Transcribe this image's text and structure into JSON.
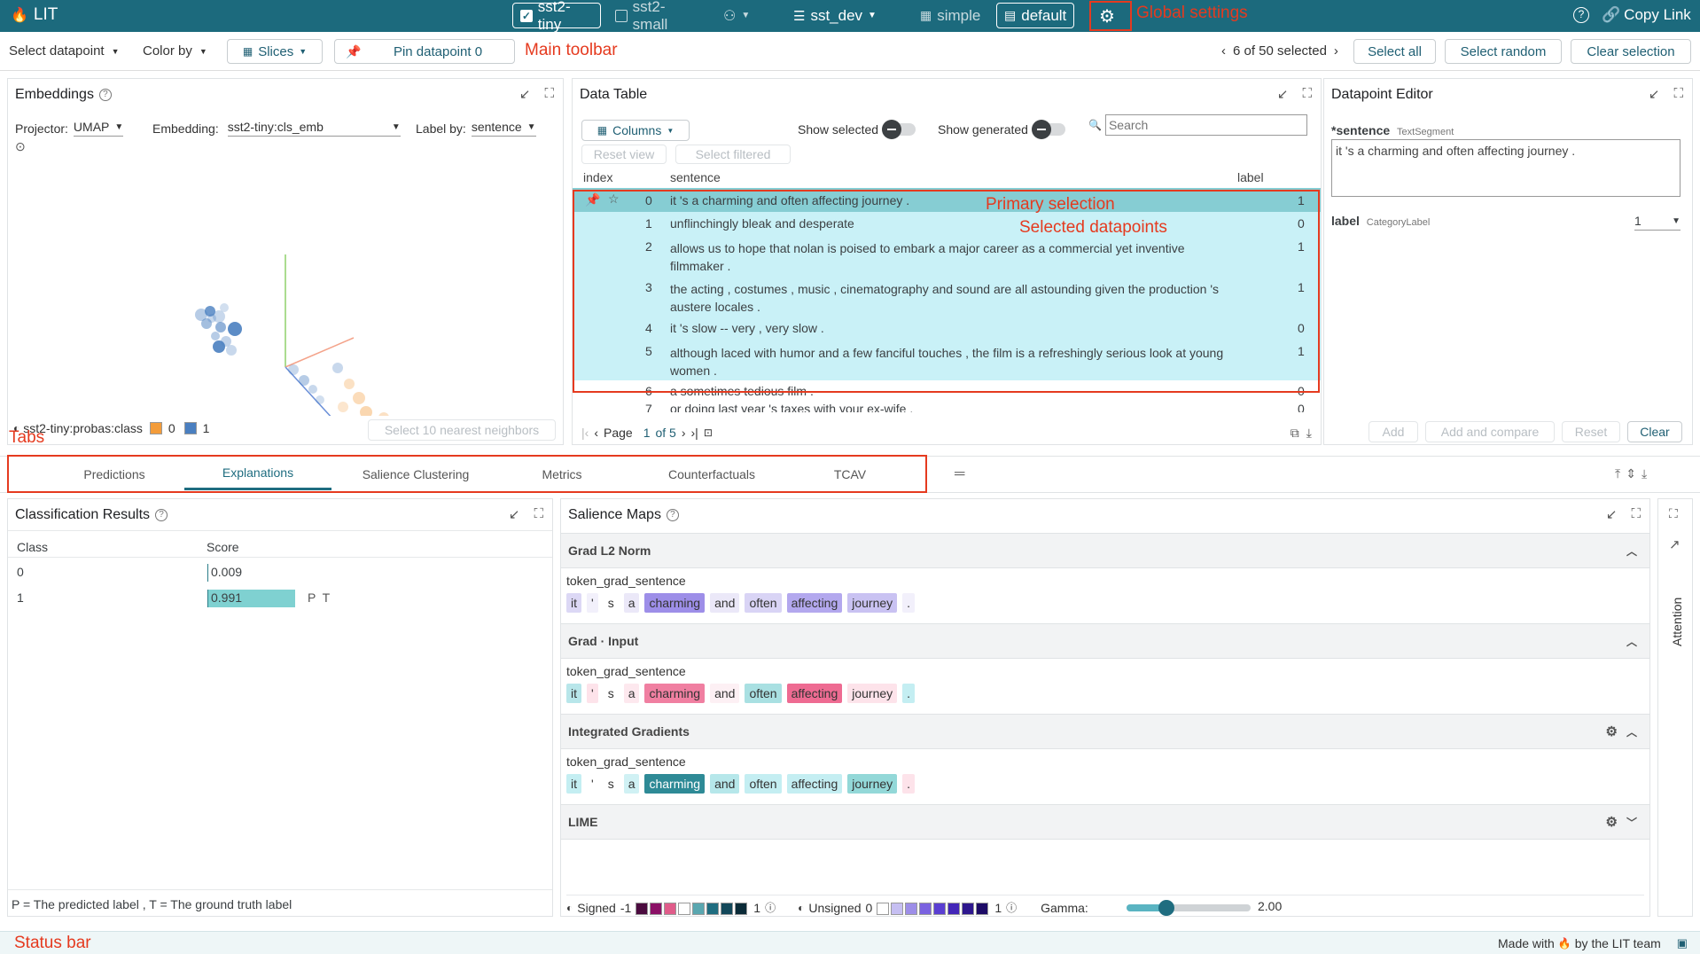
{
  "app": {
    "title": "LIT",
    "flame": "🔥"
  },
  "topbar": {
    "models": [
      {
        "label": "sst2-tiny",
        "checked": true
      },
      {
        "label": "sst2-small",
        "checked": false
      }
    ],
    "dataset": "sst_dev",
    "layouts": {
      "simple": "simple",
      "default": "default"
    },
    "copy_link": "Copy Link"
  },
  "toolbar": {
    "select_datapoint": "Select datapoint",
    "color_by": "Color by",
    "slices": "Slices",
    "pin": "Pin datapoint 0",
    "selected_count": "6 of 50 selected",
    "select_all": "Select all",
    "select_random": "Select random",
    "clear_selection": "Clear selection"
  },
  "annotations": {
    "global_settings": "Global settings",
    "main_toolbar": "Main toolbar",
    "primary_selection": "Primary selection",
    "selected_datapoints": "Selected datapoints",
    "tabs": "Tabs",
    "status_bar": "Status bar"
  },
  "embeddings": {
    "title": "Embeddings",
    "projector_label": "Projector:",
    "projector": "UMAP",
    "embedding_label": "Embedding:",
    "embedding": "sst2-tiny:cls_emb",
    "label_by_label": "Label by:",
    "label_by": "sentence",
    "legend_field": "sst2-tiny:probas:class",
    "legend_0": "0",
    "legend_1": "1",
    "nn_button": "Select 10 nearest neighbors",
    "colors": {
      "class0": "#f39c3a",
      "class1": "#4a7fc0"
    }
  },
  "data_table": {
    "title": "Data Table",
    "columns_button": "Columns",
    "show_selected": "Show selected",
    "show_generated": "Show generated",
    "search_placeholder": "Search",
    "reset_view": "Reset view",
    "select_filtered": "Select filtered",
    "headers": {
      "index": "index",
      "sentence": "sentence",
      "label": "label"
    },
    "rows": [
      {
        "index": "0",
        "sentence": "it 's a charming and often affecting journey .",
        "label": "1"
      },
      {
        "index": "1",
        "sentence": "unflinchingly bleak and desperate",
        "label": "0"
      },
      {
        "index": "2",
        "sentence": "allows us to hope that nolan is poised to embark a major career as a commercial yet inventive filmmaker .",
        "label": "1"
      },
      {
        "index": "3",
        "sentence": "the acting , costumes , music , cinematography and sound are all astounding given the production 's austere locales .",
        "label": "1"
      },
      {
        "index": "4",
        "sentence": "it 's slow -- very , very slow .",
        "label": "0"
      },
      {
        "index": "5",
        "sentence": "although laced with humor and a few fanciful touches , the film is a refreshingly serious look at young women .",
        "label": "1"
      },
      {
        "index": "6",
        "sentence": "a sometimes tedious film .",
        "label": "0"
      },
      {
        "index": "7",
        "sentence": "or doing last year 's taxes with your ex-wife .",
        "label": "0"
      }
    ],
    "page_label": "Page",
    "page_num": "1",
    "page_of": "of 5"
  },
  "editor": {
    "title": "Datapoint Editor",
    "sentence_label": "*sentence",
    "sentence_type": "TextSegment",
    "sentence_value": "it 's a charming and often affecting journey .",
    "label_label": "label",
    "label_type": "CategoryLabel",
    "label_value": "1",
    "add": "Add",
    "add_compare": "Add and compare",
    "reset": "Reset",
    "clear": "Clear"
  },
  "tabs": [
    "Predictions",
    "Explanations",
    "Salience Clustering",
    "Metrics",
    "Counterfactuals",
    "TCAV"
  ],
  "active_tab": "Explanations",
  "classification": {
    "title": "Classification Results",
    "headers": {
      "class": "Class",
      "score": "Score"
    },
    "rows": [
      {
        "class": "0",
        "score": 0.009,
        "score_text": "0.009",
        "tags": ""
      },
      {
        "class": "1",
        "score": 0.991,
        "score_text": "0.991",
        "tags": "P  T"
      }
    ],
    "footer": "P = The predicted label , T = The ground truth label"
  },
  "salience": {
    "title": "Salience Maps",
    "sections": [
      {
        "name": "Grad L2 Norm",
        "field": "token_grad_sentence",
        "tokens": [
          [
            "it",
            "#dcd8f5"
          ],
          [
            "'",
            "#f2f0fb"
          ],
          [
            "s",
            "#ffffff"
          ],
          [
            "a",
            "#ebe8f8"
          ],
          [
            "charming",
            "#9d8ee8"
          ],
          [
            "and",
            "#ebe8f8"
          ],
          [
            "often",
            "#d9d4f5"
          ],
          [
            "affecting",
            "#b3a8ee"
          ],
          [
            "journey",
            "#c9c2f2"
          ],
          [
            ".",
            "#f2f0fb"
          ]
        ]
      },
      {
        "name": "Grad · Input",
        "field": "token_grad_sentence",
        "tokens": [
          [
            "it",
            "#b8e6ea"
          ],
          [
            "'",
            "#fde3ea"
          ],
          [
            "s",
            "#ffffff"
          ],
          [
            "a",
            "#fde8ee"
          ],
          [
            "charming",
            "#f07fa1"
          ],
          [
            "and",
            "#fdf0f4"
          ],
          [
            "often",
            "#a9e0e2"
          ],
          [
            "affecting",
            "#ee6b92"
          ],
          [
            "journey",
            "#fde3ea"
          ],
          [
            ".",
            "#c4eef2"
          ]
        ]
      },
      {
        "name": "Integrated Gradients",
        "field": "token_grad_sentence",
        "tokens": [
          [
            "it",
            "#c4eef2"
          ],
          [
            "'",
            "#ffffff"
          ],
          [
            "s",
            "#ffffff"
          ],
          [
            "a",
            "#d0f1f4"
          ],
          [
            "charming",
            "#2e8a96"
          ],
          [
            "and",
            "#b6e7ea"
          ],
          [
            "often",
            "#c4eef2"
          ],
          [
            "affecting",
            "#c4eef2"
          ],
          [
            "journey",
            "#93d8d8"
          ],
          [
            ".",
            "#fde3ea"
          ]
        ]
      },
      {
        "name": "LIME",
        "field": "",
        "tokens": []
      }
    ],
    "legend": {
      "signed": "Signed",
      "signed_min": "-1",
      "signed_max": "1",
      "signed_colors": [
        "#4b0b3f",
        "#8b1066",
        "#e05c8a",
        "#ffffff",
        "#5aa7b0",
        "#1f6d80",
        "#13485a",
        "#0b2b38"
      ],
      "unsigned": "Unsigned",
      "unsigned_min": "0",
      "unsigned_max": "1",
      "unsigned_colors": [
        "#ffffff",
        "#c6bff2",
        "#9d8ee8",
        "#7a62e0",
        "#5a3fd2",
        "#4326b8",
        "#2e178e",
        "#1d0b66"
      ],
      "gamma_label": "Gamma:",
      "gamma_value": "2.00",
      "gamma_level": 0.32
    }
  },
  "attention": {
    "label": "Attention"
  },
  "status": {
    "made_with": "Made with",
    "by": "by the LIT team"
  }
}
